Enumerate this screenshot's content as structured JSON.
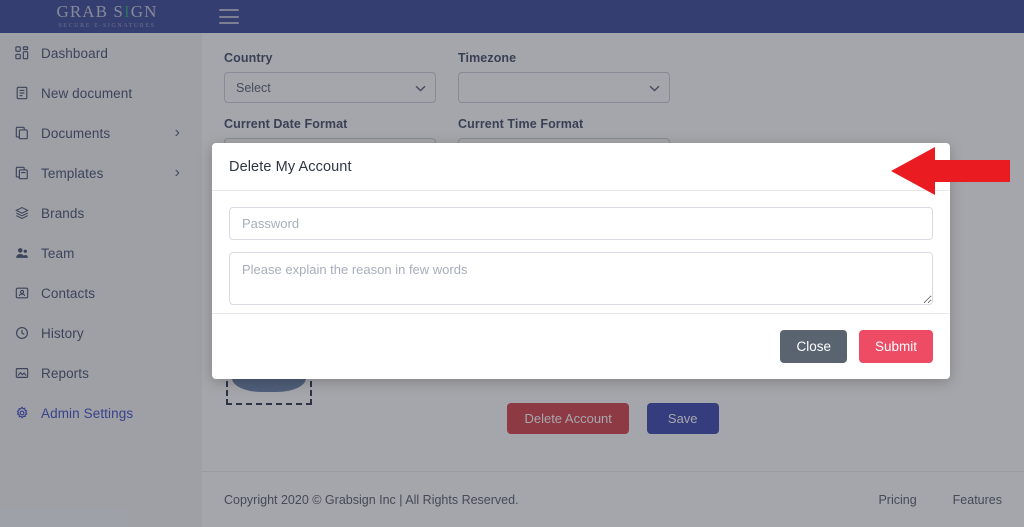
{
  "brand": {
    "logo_main_before": "GRAB S",
    "logo_main_slash": "I",
    "logo_main_after": "GN",
    "logo_tagline": "SECURE E-SIGNATURES",
    "accent_blue": "#3f4c9c",
    "accent_green": "#35a07f",
    "link_blue": "#4453c4"
  },
  "topbar": {
    "menu_icon": "hamburger-icon"
  },
  "sidebar": {
    "items": [
      {
        "label": "Dashboard",
        "icon": "grid-icon",
        "chevron": false,
        "active": false
      },
      {
        "label": "New document",
        "icon": "document-icon",
        "chevron": false,
        "active": false
      },
      {
        "label": "Documents",
        "icon": "copy-icon",
        "chevron": true,
        "active": false
      },
      {
        "label": "Templates",
        "icon": "layers-copy-icon",
        "chevron": true,
        "active": false
      },
      {
        "label": "Brands",
        "icon": "stack-icon",
        "chevron": false,
        "active": false
      },
      {
        "label": "Team",
        "icon": "people-icon",
        "chevron": false,
        "active": false
      },
      {
        "label": "Contacts",
        "icon": "contact-card-icon",
        "chevron": false,
        "active": false
      },
      {
        "label": "History",
        "icon": "clock-icon",
        "chevron": false,
        "active": false
      },
      {
        "label": "Reports",
        "icon": "image-report-icon",
        "chevron": false,
        "active": false
      },
      {
        "label": "Admin Settings",
        "icon": "gear-icon",
        "chevron": false,
        "active": true
      }
    ],
    "chevron_glyph": "›"
  },
  "form": {
    "fields": [
      {
        "label": "Country",
        "value": "Select"
      },
      {
        "label": "Timezone",
        "value": ""
      },
      {
        "label": "Current Date Format",
        "value": ""
      },
      {
        "label": "Current Time Format",
        "value": ""
      }
    ],
    "caret_glyph": "⌄"
  },
  "actions": {
    "delete_label": "Delete Account",
    "save_label": "Save",
    "delete_color": "#d64550",
    "save_color": "#3f4ab4"
  },
  "footer": {
    "copyright": "Copyright 2020 © Grabsign Inc | All Rights Reserved.",
    "links": [
      "Pricing",
      "Features"
    ]
  },
  "modal": {
    "title": "Delete My Account",
    "password_placeholder": "Password",
    "password_value": "",
    "reason_placeholder": "Please explain the reason in few words",
    "reason_value": "",
    "close_label": "Close",
    "submit_label": "Submit",
    "close_color": "#5a6470",
    "submit_color": "#ee4b64"
  },
  "annotation": {
    "arrow_name": "red-arrow-pointer",
    "arrow_color": "#ea1c22",
    "direction": "left"
  }
}
